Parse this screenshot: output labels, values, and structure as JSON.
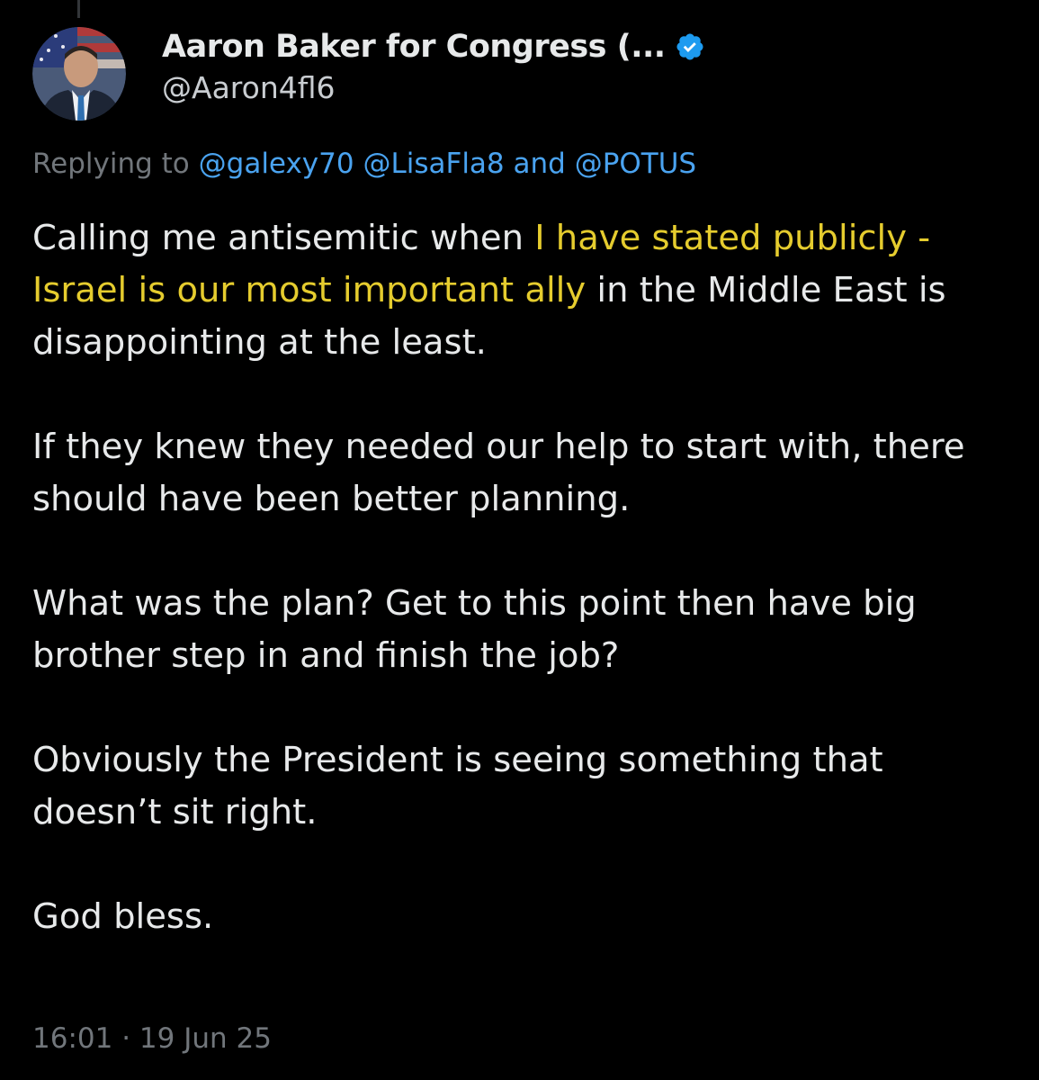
{
  "tweet": {
    "display_name": "Aaron Baker for Congress (...",
    "handle": "@Aaron4fl6",
    "verified_icon": "verified-badge-icon",
    "replying_prefix": "Replying to",
    "mention_1": "@galexy70",
    "mention_2": "@LisaFla8",
    "replying_and": "and",
    "mention_3": "@POTUS",
    "p1_a": "Calling me antisemitic when ",
    "p1_hl": "I have stated publicly - Israel is our most important ally",
    "p1_b": " in the Middle East is disappointing at the least.",
    "p2": "If they knew they needed our help to start with, there should have been better planning.",
    "p3": "What was the plan? Get to this point then have big brother step in and finish the job?",
    "p4": "Obviously the President is seeing something that doesn’t sit right.",
    "p5": "God bless.",
    "timestamp": "16:01 · 19 Jun 25"
  },
  "colors": {
    "background": "#000000",
    "text": "#e7e9ea",
    "muted": "#71767b",
    "mention": "#4aa3f0",
    "highlight": "#e5cc2e",
    "verified": "#1d9bf0"
  }
}
